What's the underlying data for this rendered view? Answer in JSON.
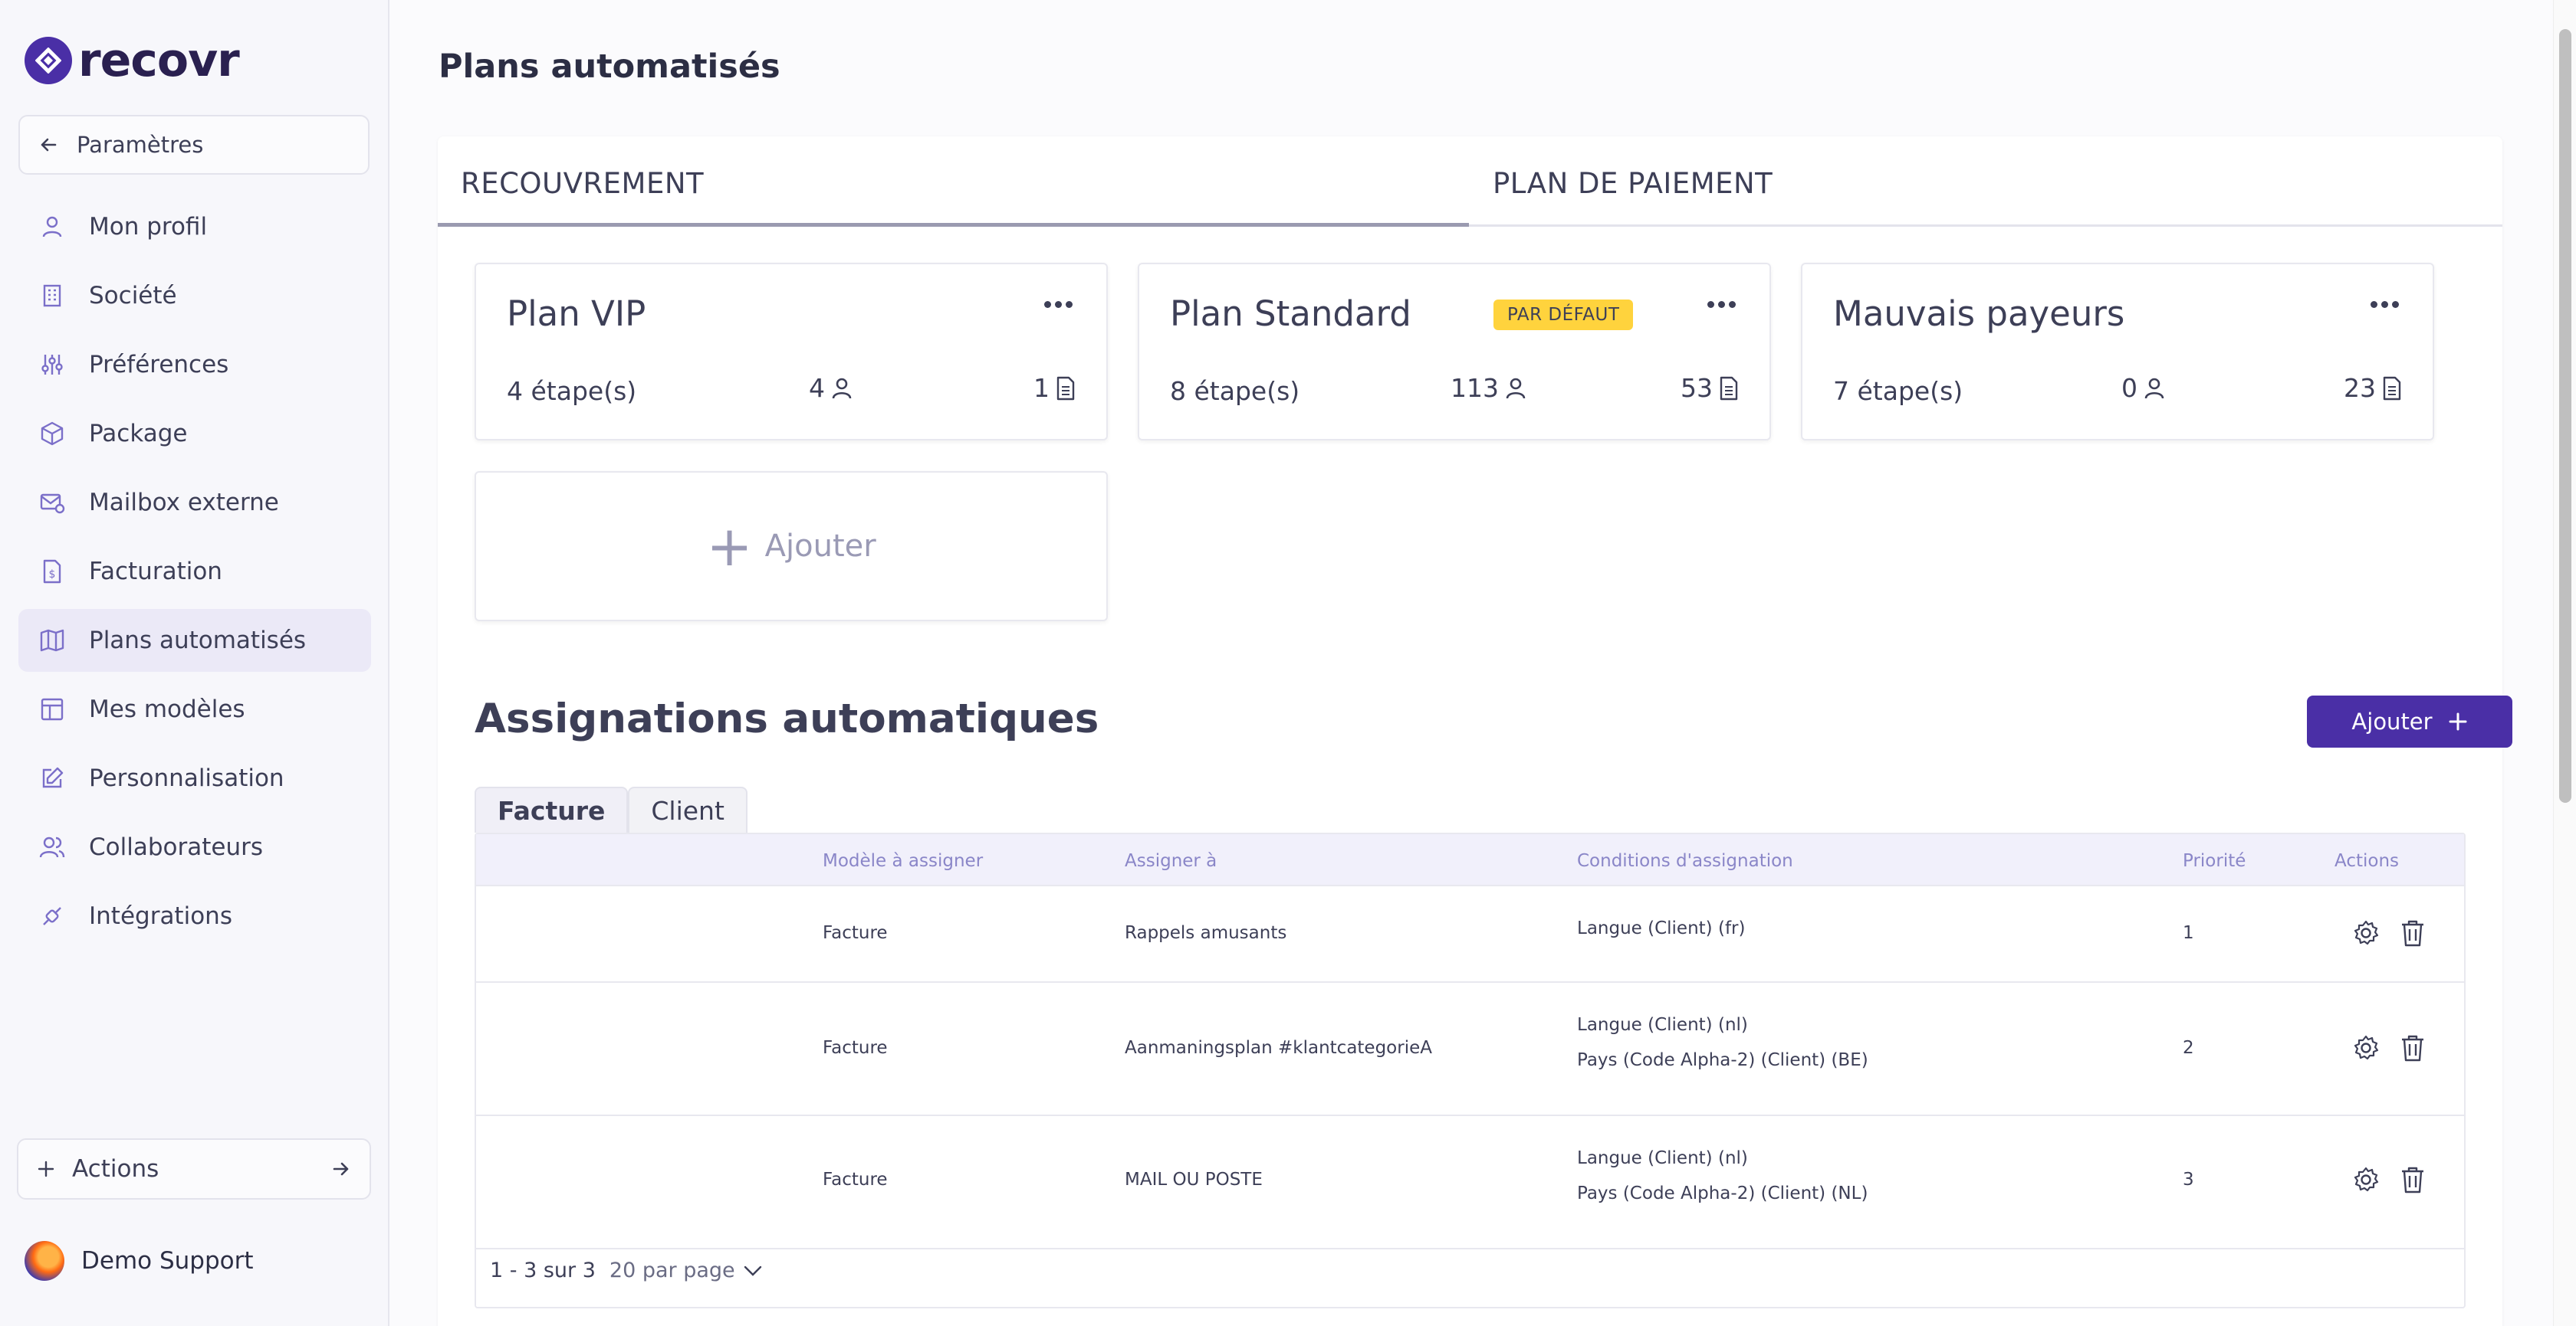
{
  "app": {
    "logo_text": "recovr",
    "brand_color": "#4a2fa6"
  },
  "sidebar": {
    "back_label": "Paramètres",
    "items": [
      {
        "label": "Mon profil",
        "icon": "user-icon",
        "active": false
      },
      {
        "label": "Société",
        "icon": "building-icon",
        "active": false
      },
      {
        "label": "Préférences",
        "icon": "sliders-icon",
        "active": false
      },
      {
        "label": "Package",
        "icon": "package-icon",
        "active": false
      },
      {
        "label": "Mailbox externe",
        "icon": "mail-settings-icon",
        "active": false
      },
      {
        "label": "Facturation",
        "icon": "invoice-icon",
        "active": false
      },
      {
        "label": "Plans automatisés",
        "icon": "map-icon",
        "active": true
      },
      {
        "label": "Mes modèles",
        "icon": "template-icon",
        "active": false
      },
      {
        "label": "Personnalisation",
        "icon": "edit-icon",
        "active": false
      },
      {
        "label": "Collaborateurs",
        "icon": "users-icon",
        "active": false
      },
      {
        "label": "Intégrations",
        "icon": "plug-icon",
        "active": false
      }
    ],
    "actions_label": "Actions",
    "user_name": "Demo Support"
  },
  "page": {
    "title": "Plans automatisés",
    "tabs": [
      "RECOUVREMENT",
      "PLAN DE PAIEMENT"
    ],
    "active_tab": "RECOUVREMENT"
  },
  "plans": [
    {
      "name": "Plan VIP",
      "steps": "4 étape(s)",
      "users": "4",
      "docs": "1",
      "badge": ""
    },
    {
      "name": "Plan Standard",
      "steps": "8 étape(s)",
      "users": "113",
      "docs": "53",
      "badge": "PAR DÉFAUT"
    },
    {
      "name": "Mauvais payeurs",
      "steps": "7 étape(s)",
      "users": "0",
      "docs": "23",
      "badge": ""
    }
  ],
  "add_plan_label": "Ajouter",
  "assignments": {
    "title": "Assignations automatiques",
    "add_label": "Ajouter",
    "subtabs": [
      "Facture",
      "Client"
    ],
    "active_subtab": "Facture",
    "columns": [
      "Modèle à assigner",
      "Assigner à",
      "Conditions d'assignation",
      "Priorité",
      "Actions"
    ],
    "rows": [
      {
        "model": "Facture",
        "assign_to": "Rappels amusants",
        "conditions": [
          "Langue (Client) (fr)"
        ],
        "priority": "1"
      },
      {
        "model": "Facture",
        "assign_to": "Aanmaningsplan #klantcategorieA",
        "conditions": [
          "Langue (Client) (nl)",
          "Pays (Code Alpha-2) (Client) (BE)"
        ],
        "priority": "2"
      },
      {
        "model": "Facture",
        "assign_to": "MAIL OU POSTE",
        "conditions": [
          "Langue (Client) (nl)",
          "Pays (Code Alpha-2) (Client) (NL)"
        ],
        "priority": "3"
      }
    ],
    "pagination": {
      "range": "1 - 3 sur 3",
      "per_page": "20 par page"
    }
  }
}
